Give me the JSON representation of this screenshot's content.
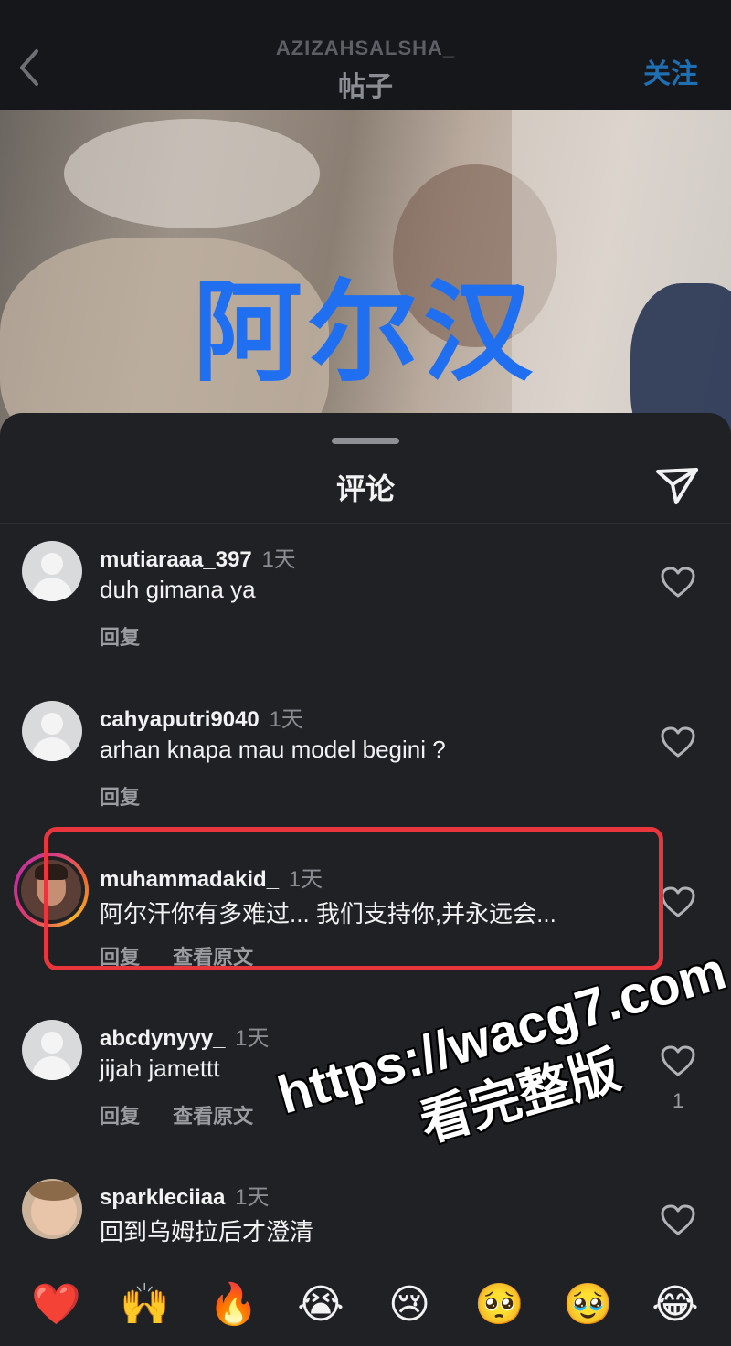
{
  "header": {
    "username": "AZIZAHSALSHA_",
    "title": "帖子",
    "follow_label": "关注"
  },
  "post": {
    "overlay_text": "阿尔汉"
  },
  "comments_sheet": {
    "title": "评论",
    "comments": [
      {
        "username": "mutiaraaa_397",
        "time": "1天",
        "text": "duh gimana ya",
        "reply_label": "回复"
      },
      {
        "username": "cahyaputri9040",
        "time": "1天",
        "text": "arhan knapa mau model begini ?",
        "reply_label": "回复"
      },
      {
        "username": "muhammadakid_",
        "time": "1天",
        "text": "阿尔汗你有多难过... 我们支持你,并永远会...",
        "reply_label": "回复",
        "translate_label": "查看原文"
      },
      {
        "username": "abcdynyyy_",
        "time": "1天",
        "text": "jijah jamettt",
        "reply_label": "回复",
        "translate_label": "查看原文",
        "like_count": "1"
      },
      {
        "username": "sparkleciiaa",
        "time": "1天",
        "text": "回到乌姆拉后才澄清"
      }
    ]
  },
  "watermark": {
    "url": "https://wacg7.com",
    "text": "看完整版"
  },
  "emoji_bar": [
    "❤️",
    "🙌",
    "🔥",
    "😭",
    "😢",
    "🥺",
    "🥹",
    "😂"
  ],
  "colors": {
    "accent_blue": "#1f6ff0",
    "highlight_red": "#e8363c",
    "sheet_bg": "#1f2125"
  }
}
